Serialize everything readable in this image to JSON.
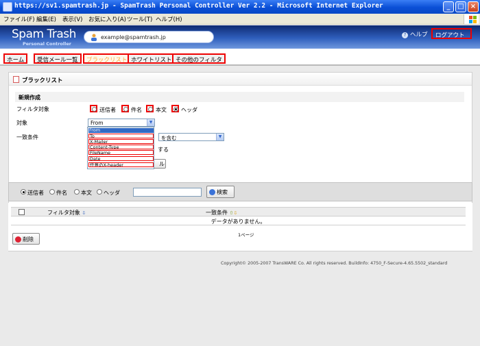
{
  "window": {
    "title": "https://sv1.spamtrash.jp - SpamTrash Personal Controller Ver 2.2 - Microsoft Internet Explorer"
  },
  "menu": [
    "ファイル(F)",
    "編集(E)",
    "表示(V)",
    "お気に入り(A)",
    "ツール(T)",
    "ヘルプ(H)"
  ],
  "header": {
    "logo": "Spam Trash",
    "logo_sub": "Personal Controller",
    "email": "example@spamtrash.jp",
    "help": "ヘルプ",
    "logout": "ログアウト"
  },
  "tabs": [
    "ホーム",
    "受信メール一覧",
    "ブラックリスト",
    "ホワイトリスト",
    "その他のフィルタ"
  ],
  "panel": {
    "title": "ブラックリスト",
    "new_section": "新規作成",
    "filter_target_label": "フィルタ対象",
    "filter_options": [
      "送信者",
      "件名",
      "本文",
      "ヘッダ"
    ],
    "filter_selected": "ヘッダ",
    "target_label": "対象",
    "target_value": "From",
    "target_options": [
      "From",
      "To",
      "X-Mailer",
      "Content-Type",
      "FileName",
      "Date",
      "任意のX-header"
    ],
    "match_label": "一致条件",
    "match_value": "を含む",
    "partial_text": "する",
    "partial_button": "ル"
  },
  "search": {
    "options": [
      "送信者",
      "件名",
      "本文",
      "ヘッダ"
    ],
    "selected": "送信者",
    "button": "検索"
  },
  "table": {
    "columns": [
      "フィルタ対象",
      "一致条件"
    ],
    "empty_message": "データがありません。",
    "delete_button": "削除",
    "page_info": "1ページ"
  },
  "footer": {
    "copyright": "Copyright© 2005-2007 TransWARE Co. All rights reserved. BuildInfo: 4750_F-Secure-4.65.5502_standard"
  }
}
